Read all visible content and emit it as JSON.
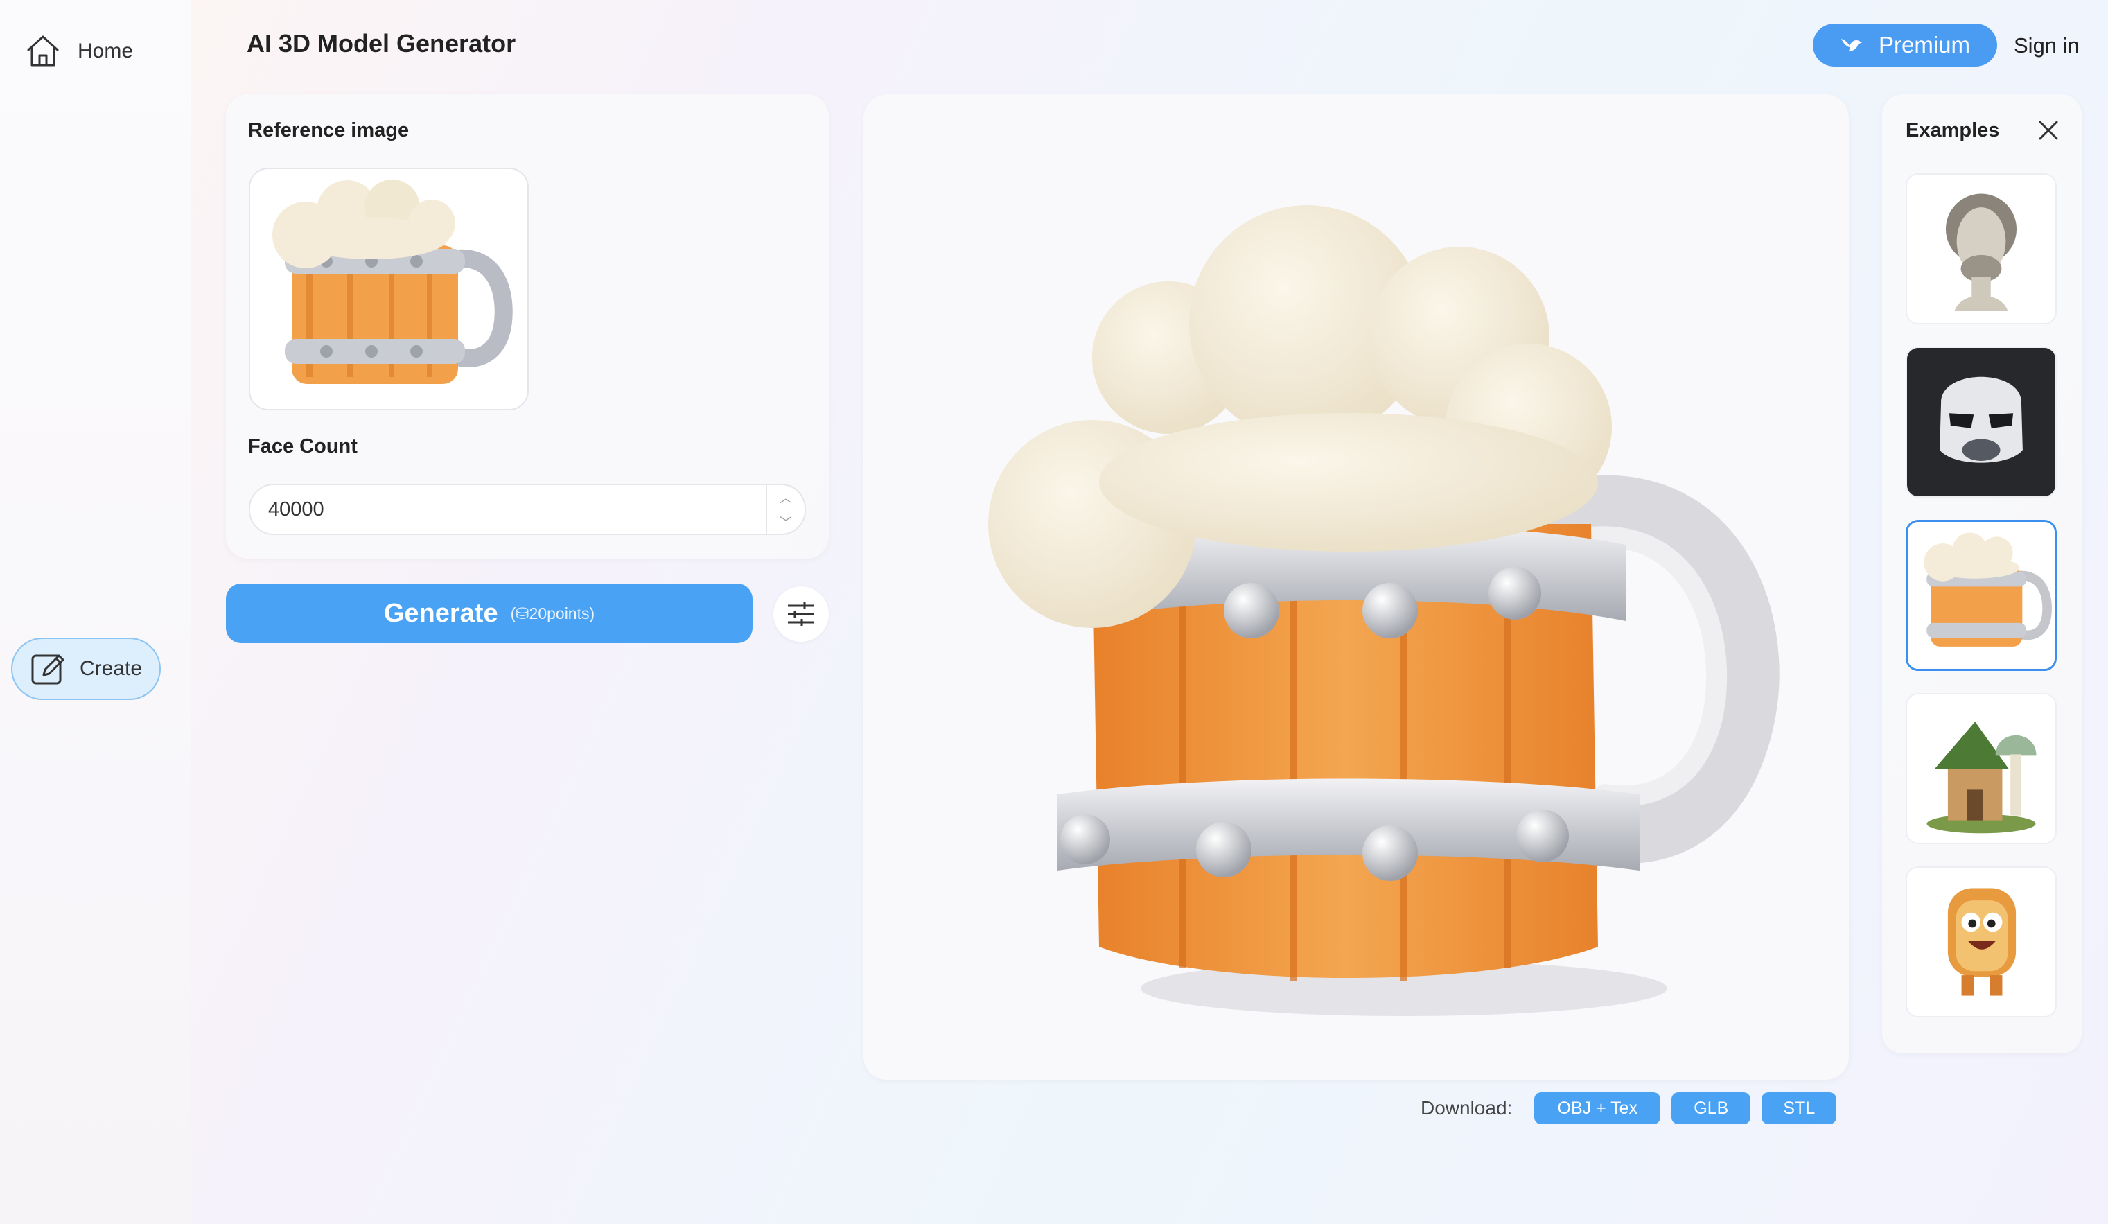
{
  "sidebar": {
    "home_label": "Home",
    "create_label": "Create"
  },
  "header": {
    "title": "AI 3D Model Generator",
    "premium_label": "Premium",
    "signin_label": "Sign in"
  },
  "form": {
    "reference_label": "Reference image",
    "face_count_label": "Face Count",
    "face_count_value": "40000",
    "generate_label": "Generate",
    "generate_cost": "(⛁20points)"
  },
  "download": {
    "label": "Download:",
    "formats": [
      "OBJ + Tex",
      "GLB",
      "STL"
    ]
  },
  "examples": {
    "title": "Examples",
    "items": [
      "marble-bust",
      "stormtrooper-helmet",
      "beer-mug",
      "mushroom-house",
      "toast-character"
    ],
    "selected": "beer-mug"
  },
  "colors": {
    "accent": "#4aa2f4",
    "premium": "#4a9cf3",
    "selected_border": "#3b90ef"
  }
}
